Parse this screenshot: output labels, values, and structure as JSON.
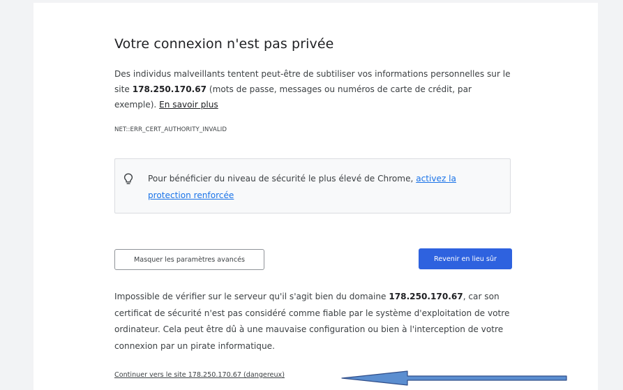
{
  "page": {
    "title": "Votre connexion n'est pas privée",
    "main_message": {
      "before": "Des individus malveillants tentent peut-être de subtiliser vos informations personnelles sur le site ",
      "host": "178.250.170.67",
      "after": " (mots de passe, messages ou numéros de carte de crédit, par exemple). ",
      "learn_more": "En savoir plus"
    },
    "error_code": "NET::ERR_CERT_AUTHORITY_INVALID",
    "enhanced_protection": {
      "text": "Pour bénéficier du niveau de sécurité le plus élevé de Chrome, ",
      "link": "activez la protection renforcée"
    },
    "buttons": {
      "hide_advanced": "Masquer les paramètres avancés",
      "back_to_safety": "Revenir en lieu sûr"
    },
    "details": {
      "before": "Impossible de vérifier sur le serveur qu'il s'agit bien du domaine ",
      "host": "178.250.170.67",
      "after": ", car son certificat de sécurité n'est pas considéré comme fiable par le système d'exploitation de votre ordinateur. Cela peut être dû à une mauvaise configuration ou bien à l'interception de votre connexion par un pirate informatique."
    },
    "proceed_link": "Continuer vers le site 178.250.170.67 (dangereux)"
  },
  "icons": {
    "alert": "alert-icon",
    "bulb": "lightbulb-icon",
    "annotation": "arrow-annotation"
  },
  "colors": {
    "page_background": "#f2f3f5",
    "content_background": "#ffffff",
    "alert_red": "#d93025",
    "primary_button": "#2e62df",
    "link_blue": "#1a73e8",
    "arrow_fill": "#5b8ed0",
    "arrow_stroke": "#2f4d89"
  }
}
